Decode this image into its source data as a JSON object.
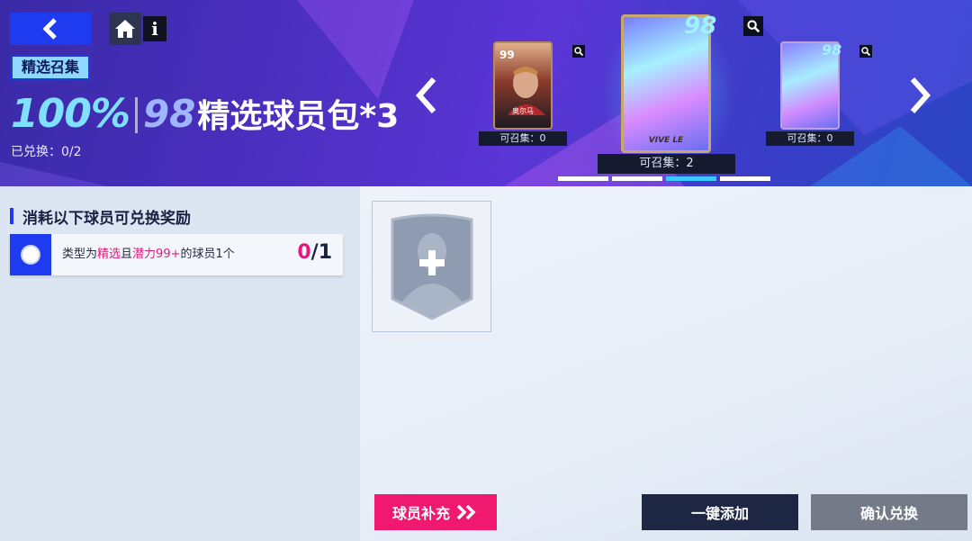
{
  "header": {
    "tag": "精选召集",
    "title_percent": "100%",
    "title_rating": "98",
    "title_name": "精选球员包*3",
    "redeemed_label": "已兑换：",
    "redeemed_value": "0/2"
  },
  "packs": [
    {
      "position": "left",
      "count_label": "可召集：",
      "count": "0",
      "player_rating": "99",
      "player_name": "奥尔马",
      "state": "side"
    },
    {
      "position": "center",
      "count_label": "可召集：",
      "count": "2",
      "rating": "98",
      "brand": "VIVE LE",
      "state": "selected"
    },
    {
      "position": "right",
      "count_label": "可召集：",
      "count": "0",
      "rating": "98",
      "state": "side"
    }
  ],
  "carousel": {
    "pages": 4,
    "active_page": 3
  },
  "requirement": {
    "heading": "消耗以下球员可兑换奖励",
    "item_text_1": "类型为",
    "item_text_highlight_1": "精选",
    "item_text_2": "且",
    "item_text_highlight_2": "潜力99+",
    "item_text_3": "的球员1个",
    "progress_current": "0",
    "progress_total": "/1"
  },
  "buttons": {
    "supply": "球员补充",
    "one_click_add": "一键添加",
    "confirm": "确认兑换"
  },
  "colors": {
    "accent_blue": "#1f3bf0",
    "highlight_pink": "#e6197a",
    "supply_button": "#f0186f",
    "dark_button": "#1d2744",
    "disabled_button": "#747a87"
  },
  "icons": [
    "back-arrow-icon",
    "home-icon",
    "info-icon",
    "zoom-icon",
    "chevron-left-icon",
    "chevron-right-icon",
    "add-player-icon",
    "double-chevron-right-icon"
  ]
}
